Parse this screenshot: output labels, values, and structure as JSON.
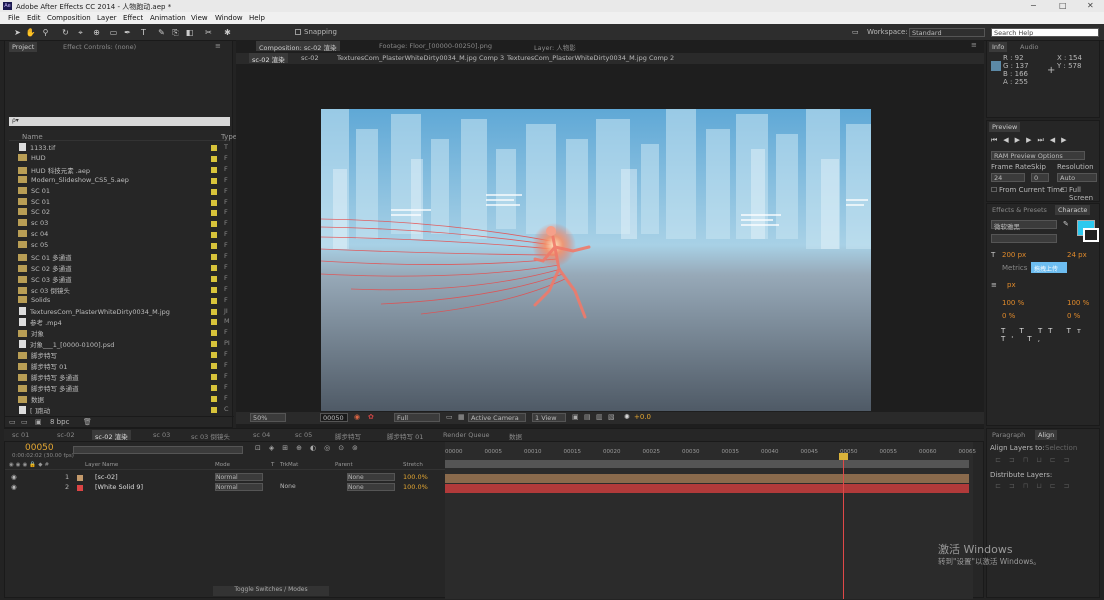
{
  "titlebar": {
    "title": "Adobe After Effects CC 2014 - 人物跑动.aep *",
    "min": "−",
    "max": "□",
    "close": "✕",
    "app_icon": "Ae"
  },
  "menu": [
    "File",
    "Edit",
    "Composition",
    "Layer",
    "Effect",
    "Animation",
    "View",
    "Window",
    "Help"
  ],
  "toolbar": {
    "snapping": "Snapping",
    "workspace_label": "Workspace:",
    "workspace_value": "Standard",
    "search_placeholder": "Search Help"
  },
  "project": {
    "tab": "Project",
    "tab2": "Effect Controls: (none)",
    "search": "ρ▾",
    "col_name": "Name",
    "col_type": "Type",
    "bpc": "8 bpc",
    "items": [
      {
        "icon": "file",
        "name": "1133.tif",
        "type": "T"
      },
      {
        "icon": "folder",
        "name": "HUD",
        "type": "F"
      },
      {
        "icon": "folder",
        "name": "HUD 科技元素 .aep",
        "type": "F"
      },
      {
        "icon": "folder",
        "name": "Modern_Slideshow_CS5_5.aep",
        "type": "F"
      },
      {
        "icon": "folder",
        "name": "SC 01",
        "type": "F"
      },
      {
        "icon": "folder",
        "name": "SC 01",
        "type": "F"
      },
      {
        "icon": "folder",
        "name": "SC 02",
        "type": "F"
      },
      {
        "icon": "folder",
        "name": "sc 03",
        "type": "F"
      },
      {
        "icon": "folder",
        "name": "sc 04",
        "type": "F"
      },
      {
        "icon": "folder",
        "name": "sc 05",
        "type": "F"
      },
      {
        "icon": "folder",
        "name": "SC 01 多通道",
        "type": "F"
      },
      {
        "icon": "folder",
        "name": "SC 02 多通道",
        "type": "F"
      },
      {
        "icon": "folder",
        "name": "SC 03 多通道",
        "type": "F"
      },
      {
        "icon": "folder",
        "name": "sc 03 倒镜头",
        "type": "F"
      },
      {
        "icon": "folder",
        "name": "Solids",
        "type": "F"
      },
      {
        "icon": "file",
        "name": "TexturesCom_PlasterWhiteDirty0034_M.jpg",
        "type": "JI"
      },
      {
        "icon": "file",
        "name": "参考 .mp4",
        "type": "M"
      },
      {
        "icon": "folder",
        "name": "对象",
        "type": "F"
      },
      {
        "icon": "file",
        "name": "对象___1_[0000-0100].psd",
        "type": "PI"
      },
      {
        "icon": "folder",
        "name": "脚步特写",
        "type": "F"
      },
      {
        "icon": "folder",
        "name": "脚步特写 01",
        "type": "F"
      },
      {
        "icon": "folder",
        "name": "脚步特写 多通道",
        "type": "F"
      },
      {
        "icon": "folder",
        "name": "脚步特写 多通道",
        "type": "F"
      },
      {
        "icon": "folder",
        "name": "数据",
        "type": "F"
      },
      {
        "icon": "file",
        "name": "[ ]跑动",
        "type": "C"
      }
    ]
  },
  "comp": {
    "tab1": "Composition: sc-02 渲染",
    "tab2": "Footage: Floor_[00000-00250].png",
    "tab3": "Layer: 人物影",
    "flow": [
      "sc-02 渲染",
      "sc-02",
      "TexturesCom_PlasterWhiteDirty0034_M.jpg Comp 3",
      "TexturesCom_PlasterWhiteDirty0034_M.jpg Comp 2"
    ],
    "zoom": "50%",
    "time": "00050",
    "quality": "Full",
    "camera": "Active Camera",
    "view": "1 View",
    "exposure": "+0.0"
  },
  "info": {
    "tab": "Info",
    "tab2": "Audio",
    "r": "R : 92",
    "g": "G : 137",
    "b": "B : 166",
    "a": "A : 255",
    "x": "X : 154",
    "y": "Y : 578"
  },
  "preview": {
    "tab": "Preview",
    "ram": "RAM Preview Options",
    "frame_rate_label": "Frame Rate",
    "skip_label": "Skip",
    "resolution_label": "Resolution",
    "frame_rate": "24",
    "skip": "0",
    "resolution": "Auto",
    "from_current": "From Current Time",
    "full_screen": "Full Screen"
  },
  "effects": {
    "tab": "Effects & Presets",
    "tab2": "Characte",
    "font": "微软雅黑",
    "size": "200 px",
    "leading": "24 px",
    "tracking": "Metrics",
    "px": "px",
    "pct1": "100 %",
    "pct2": "100 %",
    "pct3": "0 %",
    "pct4": "0 %",
    "upload": "拖拽上传"
  },
  "align": {
    "tab": "Paragraph",
    "tab2": "Align",
    "align_to": "Align Layers to:",
    "selection": "Selection",
    "distribute": "Distribute Layers:"
  },
  "timeline": {
    "tabs": [
      "sc 01",
      "sc-02",
      "sc-02 渲染",
      "sc 03",
      "sc 03 倒镜头",
      "sc 04",
      "sc 05",
      "脚步特写",
      "脚步特写 01",
      "Render Queue",
      "数据"
    ],
    "time": "00050",
    "fps": "0:00:02:02 (30.00 fps)",
    "col_layer": "Layer Name",
    "col_mode": "Mode",
    "col_t": "T",
    "col_trkmat": "TrkMat",
    "col_parent": "Parent",
    "col_stretch": "Stretch",
    "ruler": [
      "00000",
      "00005",
      "00010",
      "00015",
      "00020",
      "00025",
      "00030",
      "00035",
      "00040",
      "00045",
      "00050",
      "00055",
      "00060",
      "00065"
    ],
    "layers": [
      {
        "num": "1",
        "name": "[sc-02]",
        "mode": "Normal",
        "trkmat": "",
        "parent": "None",
        "stretch": "100.0%"
      },
      {
        "num": "2",
        "name": "[White Solid 9]",
        "mode": "Normal",
        "trkmat": "None",
        "parent": "None",
        "stretch": "100.0%"
      }
    ],
    "toggle": "Toggle Switches / Modes"
  },
  "watermark": {
    "line1": "激活 Windows",
    "line2": "转到\"设置\"以激活 Windows。"
  }
}
